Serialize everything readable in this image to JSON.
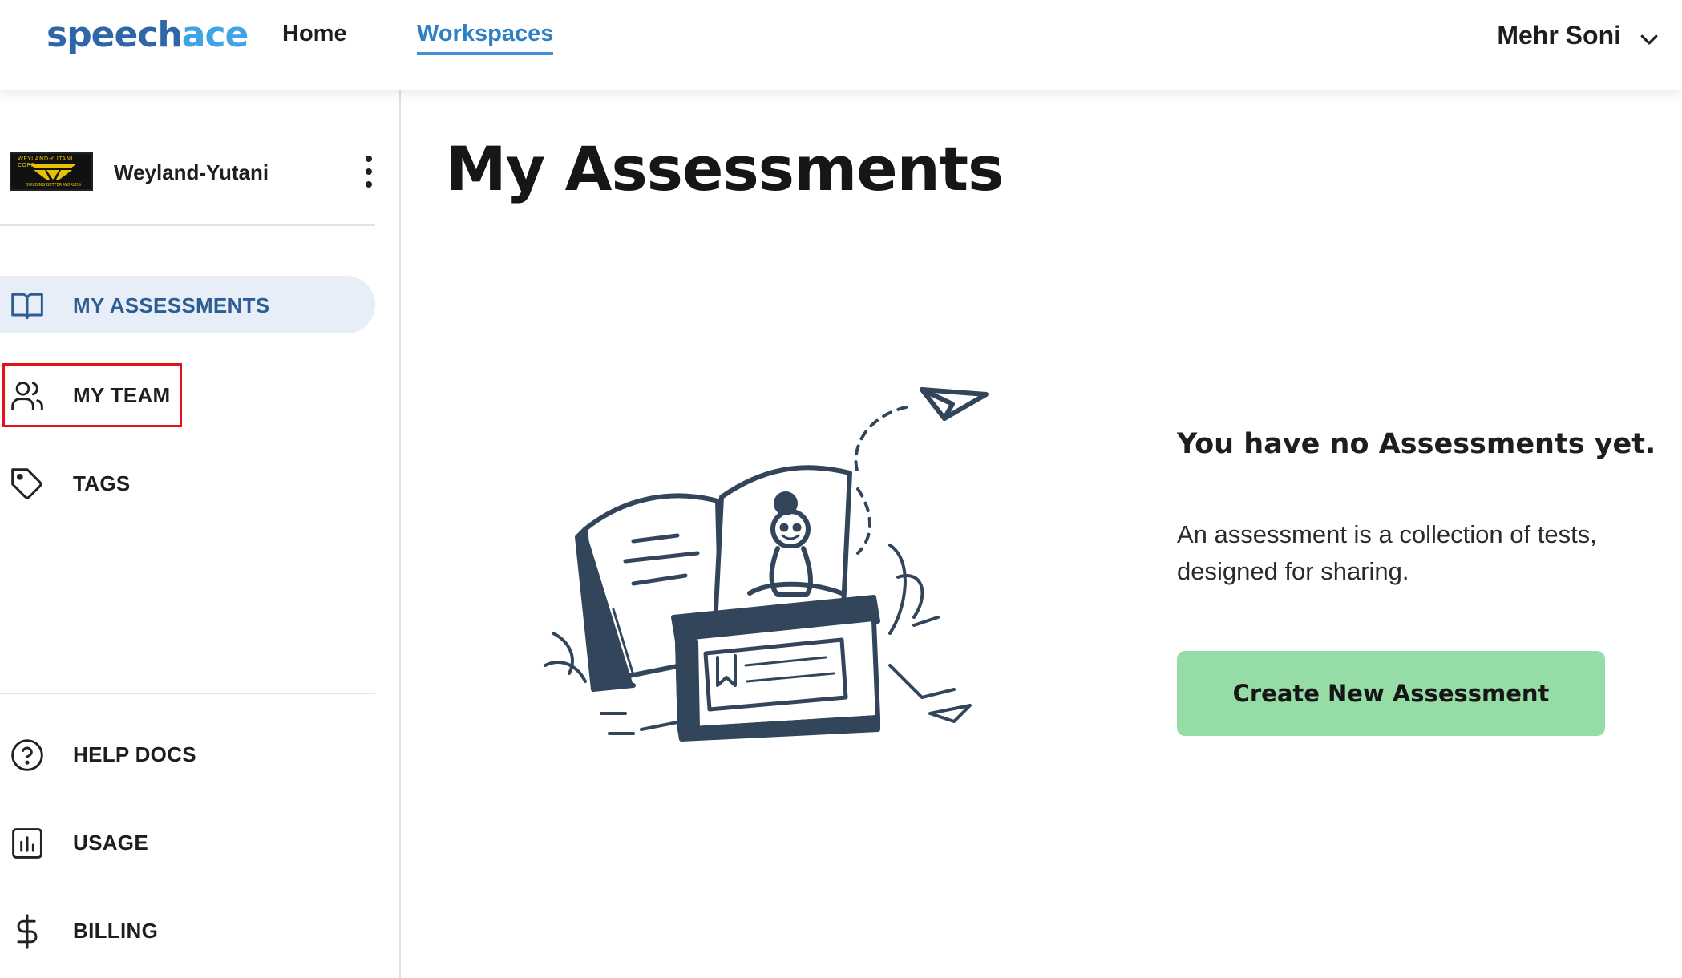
{
  "brand": {
    "part1": "speech",
    "part2": "ace"
  },
  "nav": {
    "home": "Home",
    "workspaces": "Workspaces"
  },
  "user": {
    "name": "Mehr Soni",
    "menu_icon": "chevron-down-icon"
  },
  "org": {
    "name": "Weyland-Yutani",
    "logo_top_text": "WEYLAND-YUTANI CORP",
    "logo_bottom_text": "BUILDING BETTER WORLDS",
    "menu_icon": "kebab-menu-icon"
  },
  "sidebar": {
    "items": [
      {
        "label": "MY ASSESSMENTS",
        "icon": "book-icon",
        "active": true
      },
      {
        "label": "MY TEAM",
        "icon": "users-icon",
        "highlighted": true
      },
      {
        "label": "TAGS",
        "icon": "tag-icon"
      }
    ],
    "bottom_items": [
      {
        "label": "HELP DOCS",
        "icon": "help-circle-icon"
      },
      {
        "label": "USAGE",
        "icon": "bar-chart-icon"
      },
      {
        "label": "BILLING",
        "icon": "dollar-icon"
      }
    ]
  },
  "main": {
    "title": "My Assessments",
    "empty_title": "You have no Assessments yet.",
    "empty_description": "An assessment is a collection of tests, designed for sharing.",
    "create_button": "Create New Assessment"
  },
  "colors": {
    "brand_dark": "#2f66a7",
    "brand_light": "#3fa3e6",
    "active_nav_bg": "#e8eef8",
    "active_nav_text": "#2d5d93",
    "button_bg": "#95dca6",
    "highlight_border": "#e4111b"
  }
}
